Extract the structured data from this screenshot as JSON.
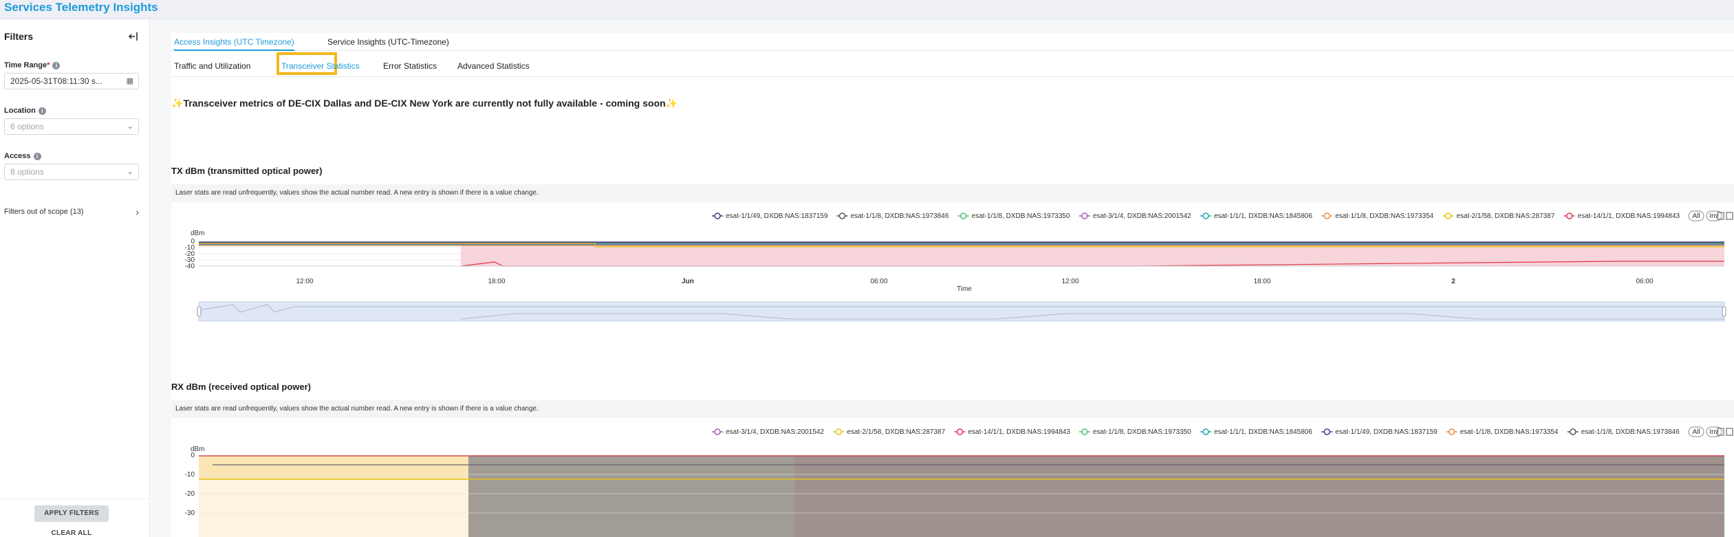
{
  "app": {
    "title": "Services Telemetry Insights"
  },
  "sidebar": {
    "title": "Filters",
    "time_range": {
      "label": "Time Range",
      "required": "*",
      "value": "2025-05-31T08:11:30 s..."
    },
    "location": {
      "label": "Location",
      "placeholder": "6 options"
    },
    "access": {
      "label": "Access",
      "placeholder": "8 options"
    },
    "out_of_scope": "Filters out of scope (13)",
    "apply_label": "APPLY FILTERS",
    "clear_label": "CLEAR ALL"
  },
  "tabs": [
    {
      "label": "Access Insights (UTC Timezone)",
      "active": true
    },
    {
      "label": "Service Insights (UTC-Timezone)",
      "active": false
    }
  ],
  "subtabs": [
    {
      "label": "Traffic and Utilization",
      "active": false
    },
    {
      "label": "Transceiver Statistics",
      "active": true
    },
    {
      "label": "Error Statistics",
      "active": false
    },
    {
      "label": "Advanced Statistics",
      "active": false
    }
  ],
  "banner": {
    "icon": "✨",
    "text": "Transceiver metrics of DE-CIX Dallas and DE-CIX New York are currently not fully available - coming soon",
    "icon_end": "✨"
  },
  "tx": {
    "title": "TX dBm (transmitted optical power)",
    "note": "Laser stats are read unfrequently, values show the actual number read. A new entry is shown if there is a value change.",
    "legend": [
      {
        "name": "esat-1/1/49, DXDB:NAS:1837159",
        "color": "#3b3f8f"
      },
      {
        "name": "esat-1/1/8, DXDB:NAS:1973846",
        "color": "#555555"
      },
      {
        "name": "esat-1/1/8, DXDB:NAS:1973350",
        "color": "#4cbf7a"
      },
      {
        "name": "esat-3/1/4, DXDB:NAS:2001542",
        "color": "#a05cc4"
      },
      {
        "name": "esat-1/1/1, DXDB:NAS:1845806",
        "color": "#1ea5b8"
      },
      {
        "name": "esat-1/1/8, DXDB:NAS:1973354",
        "color": "#f28a3a"
      },
      {
        "name": "esat-2/1/58, DXDB:NAS:287387",
        "color": "#e8c21a"
      },
      {
        "name": "esat-14/1/1, DXDB:NAS:1994843",
        "color": "#e0364a"
      }
    ],
    "ylabel": "dBm",
    "yticks": [
      "0",
      "-10",
      "-20",
      "-30",
      "-40"
    ],
    "xticks": [
      "12:00",
      "18:00",
      "Jun",
      "06:00",
      "12:00",
      "18:00",
      "2",
      "06:00"
    ],
    "xlabel": "Time",
    "controls": [
      "All",
      "Inv"
    ]
  },
  "rx": {
    "title": "RX dBm (received optical power)",
    "note": "Laser stats are read unfrequently, values show the actual number read. A new entry is shown if there is a value change.",
    "legend": [
      {
        "name": "esat-3/1/4, DXDB:NAS:2001542",
        "color": "#a05cc4"
      },
      {
        "name": "esat-2/1/58, DXDB:NAS:287387",
        "color": "#e8c21a"
      },
      {
        "name": "esat-14/1/1, DXDB:NAS:1994843",
        "color": "#e0364a"
      },
      {
        "name": "esat-1/1/8, DXDB:NAS:1973350",
        "color": "#4cbf7a"
      },
      {
        "name": "esat-1/1/1, DXDB:NAS:1845806",
        "color": "#1ea5b8"
      },
      {
        "name": "esat-1/1/49, DXDB:NAS:1837159",
        "color": "#3b3f8f"
      },
      {
        "name": "esat-1/1/8, DXDB:NAS:1973354",
        "color": "#f28a3a"
      },
      {
        "name": "esat-1/1/8, DXDB:NAS:1973846",
        "color": "#555555"
      }
    ],
    "ylabel": "dBm",
    "yticks": [
      "0",
      "-10",
      "-20",
      "-30"
    ],
    "controls": [
      "All",
      "Inv"
    ]
  }
}
